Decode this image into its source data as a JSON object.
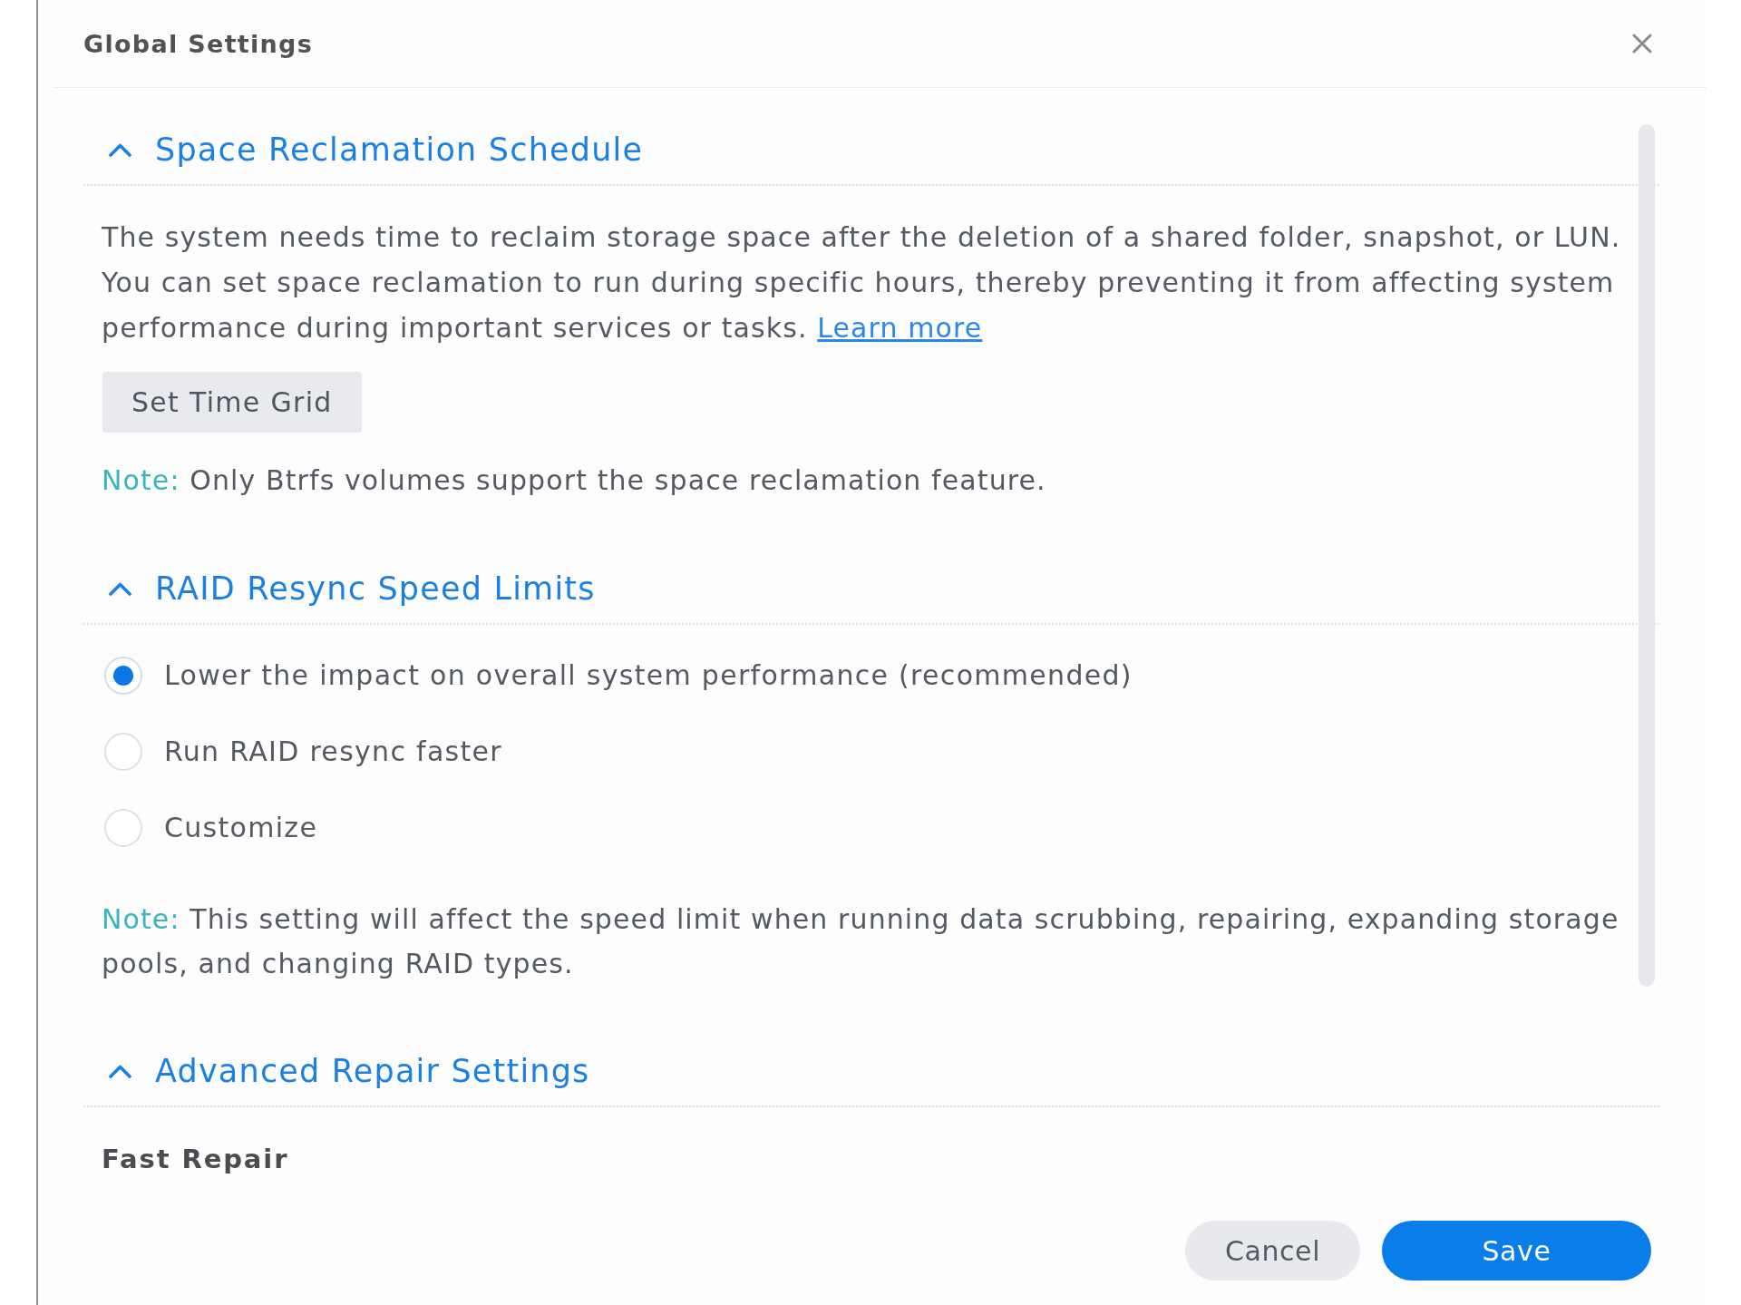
{
  "dialog": {
    "title": "Global Settings"
  },
  "sections": [
    {
      "kind": "schedule",
      "title": "Space Reclamation Schedule",
      "expanded": true,
      "description": "The system needs time to reclaim storage space after the deletion of a shared folder, snapshot, or LUN. You can set space reclamation to run during specific hours, thereby preventing it from affecting system performance during important services or tasks.",
      "link": "Learn more",
      "button": "Set Time Grid",
      "note": {
        "label": "Note:",
        "text": "Only Btrfs volumes support the space reclamation feature."
      }
    },
    {
      "kind": "radios",
      "title": "RAID Resync Speed Limits",
      "expanded": true,
      "options": [
        {
          "label": "Lower the impact on overall system performance (recommended)",
          "selected": true
        },
        {
          "label": "Run RAID resync faster",
          "selected": false
        },
        {
          "label": "Customize",
          "selected": false
        }
      ],
      "note": {
        "label": "Note:",
        "text": "This setting will affect the speed limit when running data scrubbing, repairing, expanding storage pools, and changing RAID types."
      }
    },
    {
      "kind": "subheading",
      "title": "Advanced Repair Settings",
      "expanded": true,
      "subheading": "Fast Repair"
    }
  ],
  "buttons": [
    {
      "label": "Cancel",
      "kind": "secondary"
    },
    {
      "label": "Save",
      "kind": "primary"
    }
  ]
}
